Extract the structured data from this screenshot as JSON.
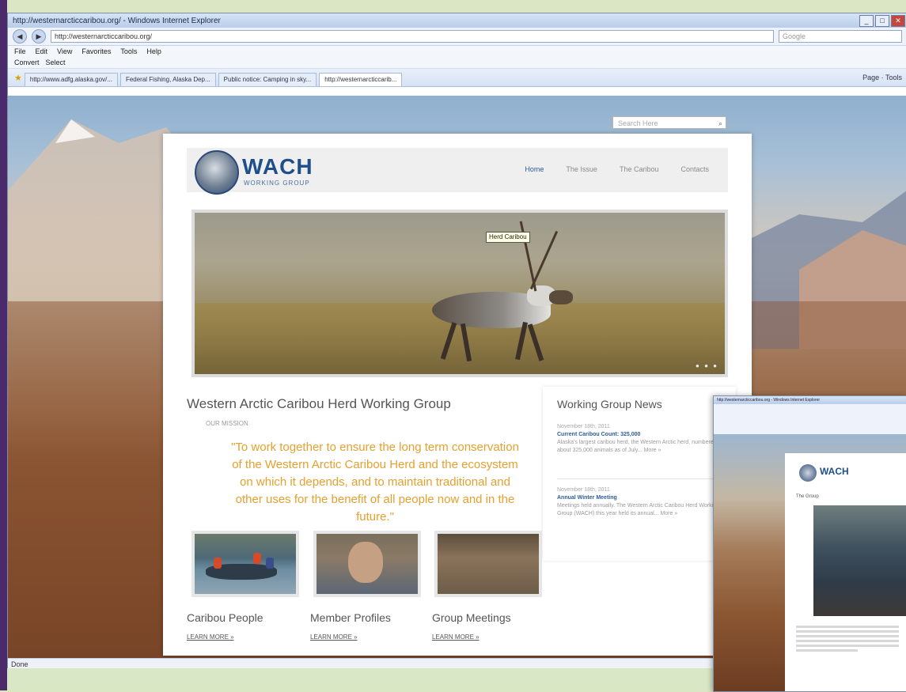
{
  "browser": {
    "title": "http://westernarcticcaribou.org/ - Windows Internet Explorer",
    "url": "http://westernarcticcaribou.org/",
    "search_placeholder": "Google",
    "menu": [
      "File",
      "Edit",
      "View",
      "Favorites",
      "Tools",
      "Help"
    ],
    "favorites": [
      "Convert",
      "Select"
    ],
    "tabs": [
      "http://www.adfg.alaska.gov/...",
      "Federal Fishing, Alaska Dep...",
      "Public notice: Camping in sky...",
      "http://westernarcticcarib..."
    ],
    "command_bar": "Page · Tools",
    "status": "Done"
  },
  "site": {
    "search_placeholder": "Search Here",
    "logo_text": "WACH",
    "logo_sub": "WORKING GROUP",
    "nav": [
      "Home",
      "The Issue",
      "The Caribou",
      "Contacts"
    ],
    "hero_tooltip": "Herd Caribou",
    "heading": "Western Arctic Caribou Herd Working Group",
    "mission_label": "OUR MISSION",
    "mission_quote": "\"To work together to ensure the long term conservation of the Western Arctic Caribou Herd and the ecosystem on which it depends, and to maintain traditional and other uses for the benefit of all people now and in the future.\"",
    "news": {
      "title": "Working Group News",
      "items": [
        {
          "date": "November 18th, 2011",
          "headline": "Current Caribou Count: 325,000",
          "body": "Alaska's largest caribou herd, the Western Arctic herd, numbered about 325,000 animals as of July... More »"
        },
        {
          "date": "November 18th, 2011",
          "headline": "Annual Winter Meeting",
          "body": "Meetings held annually. The Western Arctic Caribou Herd Working Group (WACH) this year held its annual... More »"
        }
      ]
    },
    "columns": [
      {
        "title": "Caribou People",
        "link": "LEARN MORE »"
      },
      {
        "title": "Member Profiles",
        "link": "LEARN MORE »"
      },
      {
        "title": "Group Meetings",
        "link": "LEARN MORE »"
      }
    ]
  },
  "overlay": {
    "title": "http://westernarcticcaribou.org - Windows Internet Explorer",
    "logo_text": "WACH",
    "heading": "The Group"
  }
}
